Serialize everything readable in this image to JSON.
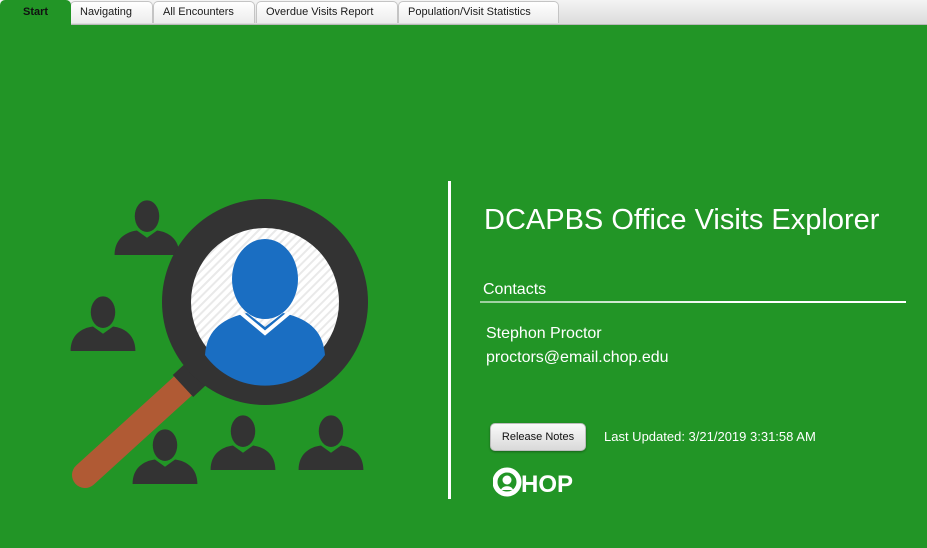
{
  "tabs": [
    {
      "label": "Start",
      "active": true
    },
    {
      "label": "Navigating",
      "active": false
    },
    {
      "label": "All Encounters",
      "active": false
    },
    {
      "label": "Overdue Visits Report",
      "active": false
    },
    {
      "label": "Population/Visit Statistics",
      "active": false
    }
  ],
  "main": {
    "title": "DCAPBS Office Visits Explorer",
    "contacts": {
      "heading": "Contacts",
      "name": "Stephon Proctor",
      "email": "proctors@email.chop.edu"
    },
    "release_notes_label": "Release Notes",
    "last_updated": "Last Updated: 3/21/2019 3:31:58 AM",
    "logo_text": "CHOP"
  },
  "colors": {
    "background": "#229526",
    "accent_person": "#1a6ec2",
    "magnifier_ring": "#333333",
    "handle": "#b05a34"
  },
  "icons": [
    "people-search-icon",
    "chop-logo"
  ]
}
